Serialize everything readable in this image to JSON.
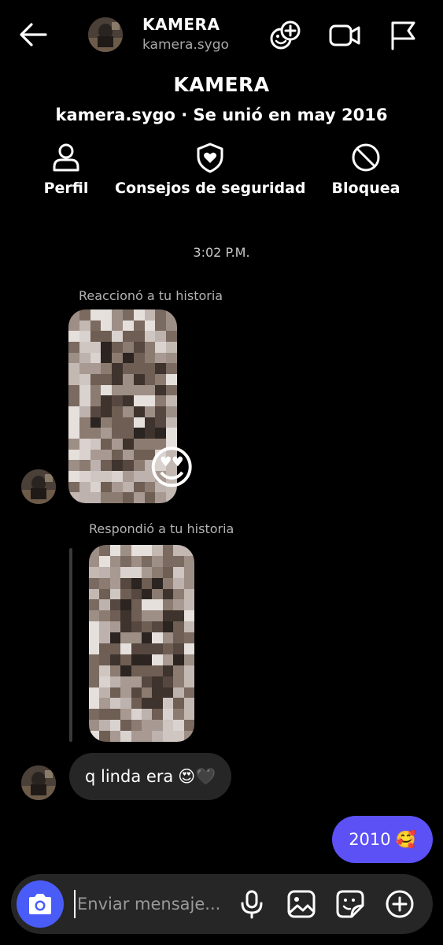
{
  "header": {
    "back_icon": "arrow-left-icon",
    "name": "KAMERA",
    "username": "kamera.sygo",
    "icons": [
      "add-people-icon",
      "video-call-icon",
      "flag-icon"
    ]
  },
  "profile": {
    "name": "KAMERA",
    "subtitle": "kamera.sygo · Se unió en may 2016",
    "actions": [
      {
        "label": "Perfil",
        "icon": "person-icon"
      },
      {
        "label": "Consejos de seguridad",
        "icon": "shield-heart-icon"
      },
      {
        "label": "Bloquea",
        "icon": "block-icon"
      }
    ]
  },
  "thread": {
    "timestamp": "3:02 P.M.",
    "story_reaction_note": "Reaccionó a tu historia",
    "reaction_emoji": "😍",
    "story_reply_note": "Respondió a tu historia",
    "incoming_message": {
      "text": "q linda era",
      "emoji": "😍🖤"
    },
    "outgoing_message": {
      "text": "2010",
      "emoji": "🥰"
    }
  },
  "composer": {
    "placeholder": "Enviar mensaje...",
    "icons": [
      "camera-icon",
      "microphone-icon",
      "gallery-icon",
      "sticker-icon",
      "plus-circle-icon"
    ]
  },
  "colors": {
    "background": "#000000",
    "incoming_bubble": "#262626",
    "outgoing_bubble": "#5b51f5",
    "camera_button": "#4a5cf7",
    "muted_text": "#a8a8a8"
  }
}
